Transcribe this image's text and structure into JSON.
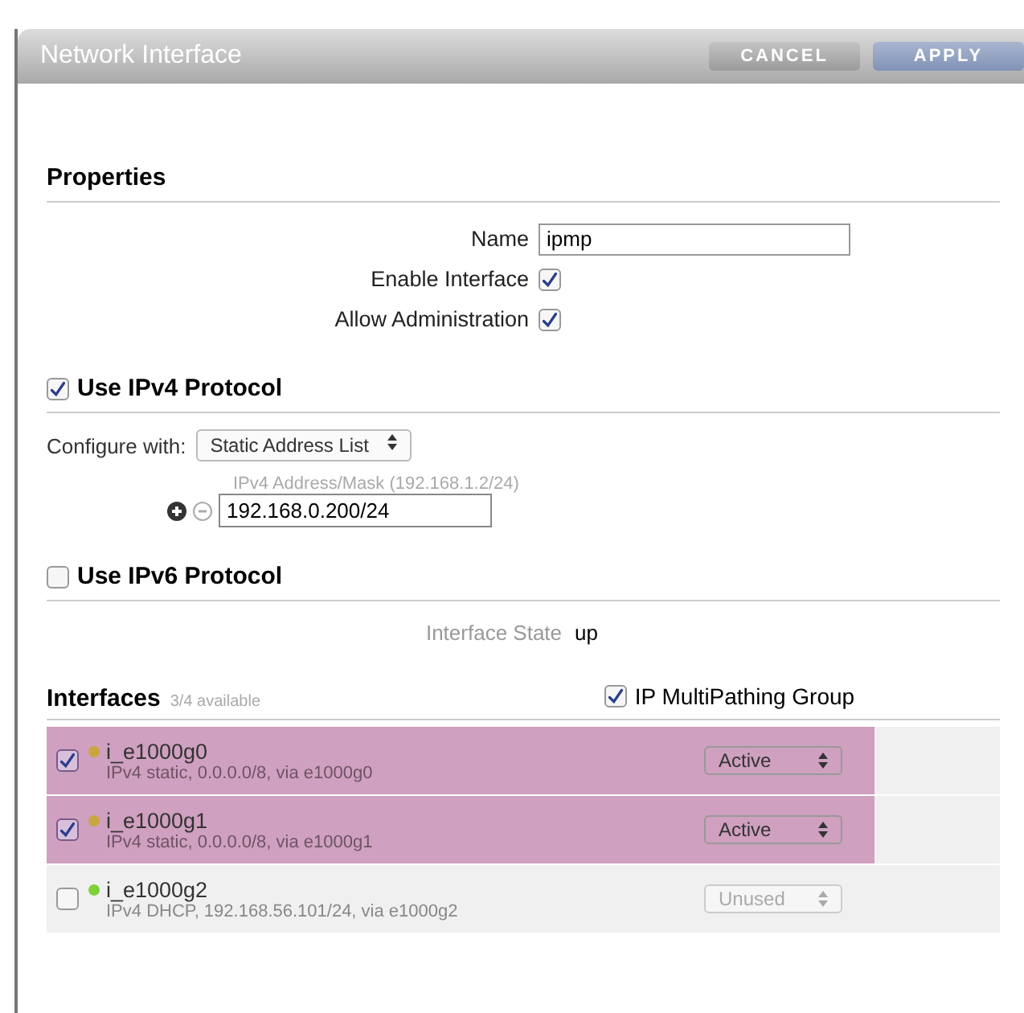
{
  "window": {
    "title": "Network Interface"
  },
  "buttons": [
    {
      "label": "CANCEL",
      "kind": "cancel"
    },
    {
      "label": "APPLY",
      "kind": "apply"
    }
  ],
  "properties": {
    "heading": "Properties",
    "name_label": "Name",
    "name_value": "ipmp",
    "enable_label": "Enable Interface",
    "enable_checked": true,
    "admin_label": "Allow Administration",
    "admin_checked": true
  },
  "ipv4": {
    "heading": "Use IPv4 Protocol",
    "checked": true,
    "configure_label": "Configure with:",
    "configure_value": "Static Address List",
    "address_label": "IPv4 Address/Mask (192.168.1.2/24)",
    "address_value": "192.168.0.200/24"
  },
  "ipv6": {
    "heading": "Use IPv6 Protocol",
    "checked": false
  },
  "state": {
    "label": "Interface State",
    "value": "up"
  },
  "interfaces": {
    "heading": "Interfaces",
    "count": "3/4 available",
    "multipath_label": "IP MultiPathing Group",
    "multipath_checked": true,
    "rows": [
      {
        "name": "i_e1000g0",
        "detail": "IPv4 static, 0.0.0.0/8, via e1000g0",
        "checked": true,
        "selected": true,
        "color": "#c9a640",
        "mode": "Active",
        "disabled": false
      },
      {
        "name": "i_e1000g1",
        "detail": "IPv4 static, 0.0.0.0/8, via e1000g1",
        "checked": true,
        "selected": true,
        "color": "#c9a640",
        "mode": "Active",
        "disabled": false
      },
      {
        "name": "i_e1000g2",
        "detail": "IPv4 DHCP, 192.168.56.101/24, via e1000g2",
        "checked": false,
        "selected": false,
        "color": "#7fd03a",
        "mode": "Unused",
        "disabled": true
      }
    ]
  }
}
